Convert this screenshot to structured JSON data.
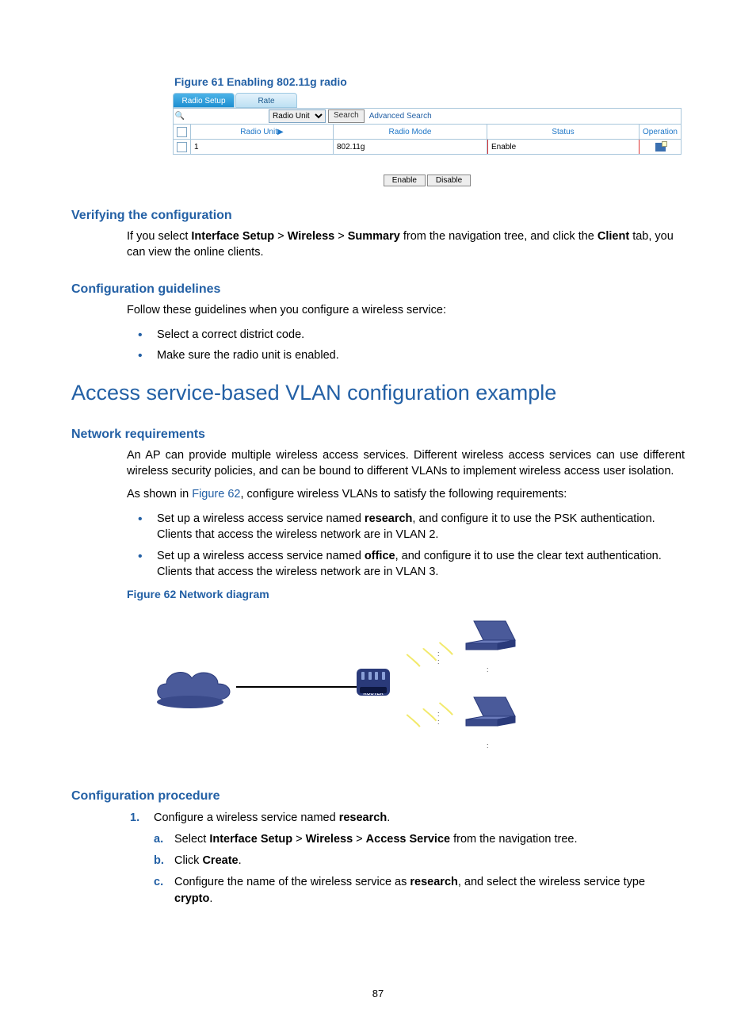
{
  "figure61": {
    "caption": "Figure 61 Enabling 802.11g radio",
    "tabs": {
      "active": "Radio Setup",
      "inactive": "Rate"
    },
    "search": {
      "select": "Radio Unit",
      "button": "Search",
      "advanced": "Advanced Search"
    },
    "headers": {
      "unit": "Radio Unit▶",
      "mode": "Radio Mode",
      "status": "Status",
      "op": "Operation"
    },
    "row": {
      "unit": "1",
      "mode": "802.11g",
      "status": "Enable"
    },
    "buttons": {
      "enable": "Enable",
      "disable": "Disable"
    }
  },
  "sections": {
    "verify_h": "Verifying the configuration",
    "verify_p_pre": "If you select ",
    "verify_nav1": "Interface Setup",
    "verify_gt": " > ",
    "verify_nav2": "Wireless",
    "verify_nav3": "Summary",
    "verify_mid": " from the navigation tree, and click the ",
    "verify_bold": "Client",
    "verify_post": " tab, you can view the online clients.",
    "guide_h": "Configuration guidelines",
    "guide_intro": "Follow these guidelines when you configure a wireless service:",
    "guide_b1": "Select a correct district code.",
    "guide_b2": "Make sure the radio unit is enabled.",
    "main_h": "Access service-based VLAN configuration example",
    "netreq_h": "Network requirements",
    "netreq_p1": "An AP can provide multiple wireless access services. Different wireless access services can use different wireless security policies, and can be bound to different VLANs to implement wireless access user isolation.",
    "netreq_p2_pre": "As shown in ",
    "netreq_link": "Figure 62",
    "netreq_p2_post": ", configure wireless VLANs to satisfy the following requirements:",
    "req1_pre": "Set up a wireless access service named ",
    "req1_bold": "research",
    "req1_post": ", and configure it to use the PSK authentication. Clients that access the wireless network are in VLAN 2.",
    "req2_pre": "Set up a wireless access service named ",
    "req2_bold": "office",
    "req2_post": ", and configure it to use the clear text authentication. Clients that access the wireless network are in VLAN 3.",
    "fig62_caption": "Figure 62 Network diagram",
    "proc_h": "Configuration procedure",
    "step1_pre": "Configure a wireless service named ",
    "step1_bold": "research",
    "step1_post": ".",
    "sa_pre": "Select ",
    "sa_n1": "Interface Setup",
    "sa_n2": "Wireless",
    "sa_n3": "Access Service",
    "sa_post": " from the navigation tree.",
    "sb_pre": "Click ",
    "sb_bold": "Create",
    "sb_post": ".",
    "sc_pre": "Configure the name of the wireless service as ",
    "sc_b1": "research",
    "sc_mid": ", and select the wireless service type ",
    "sc_b2": "crypto",
    "sc_post": "."
  },
  "pagenum": "87"
}
